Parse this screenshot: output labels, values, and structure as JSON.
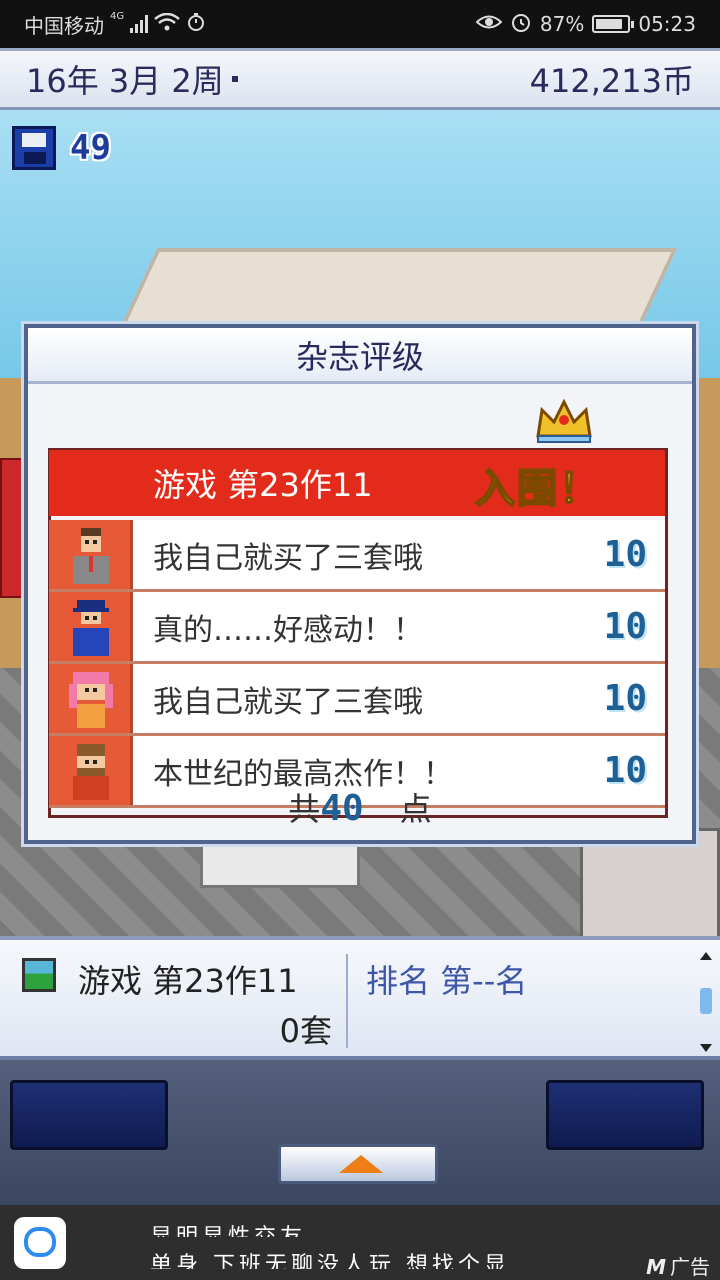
{
  "status_bar": {
    "carrier": "中国移动",
    "network": "4G",
    "battery": "87%",
    "battery_level": 0.87,
    "time": "05:23",
    "icons": [
      "signal-icon",
      "wifi-icon",
      "stopwatch-icon",
      "eye-icon",
      "alarm-icon",
      "battery-icon"
    ]
  },
  "top_bar": {
    "date": "16年 3月 2周",
    "money": "412,213币"
  },
  "save": {
    "icon": "floppy-disk-icon",
    "count": "49"
  },
  "dialog": {
    "title": "杂志评级",
    "header": "游戏 第23作11",
    "badge": "入围！",
    "crown_icon": "crown-icon",
    "reviews": [
      {
        "avatar": "reviewer-suit-man-icon",
        "comment": "我自己就买了三套哦",
        "score": "10"
      },
      {
        "avatar": "reviewer-cap-boy-icon",
        "comment": "真的……好感动！！",
        "score": "10"
      },
      {
        "avatar": "reviewer-pink-hair-girl-icon",
        "comment": "我自己就买了三套哦",
        "score": "10"
      },
      {
        "avatar": "reviewer-bearded-man-icon",
        "comment": "本世纪的最高杰作！！",
        "score": "10"
      }
    ],
    "total_prefix": "共",
    "total_value": "40",
    "total_suffix": "点"
  },
  "info_panel": {
    "game_icon": "game-cartridge-icon",
    "game_name": "游戏 第23作11",
    "sales": "0套",
    "rank": "排名 第--名"
  },
  "controls": {
    "up_icon": "arrow-up-icon"
  },
  "ad": {
    "logo_icon": "chat-app-logo-icon",
    "line1": "显明显性交友",
    "line2": "单身  下班无聊没人玩  想找个显",
    "label": "广告",
    "label_mark": "M"
  },
  "colors": {
    "header_red": "#e32b1b",
    "score_blue": "#1e5f96",
    "finalist_gold": "#f0c12a",
    "panel_border": "#4f638c"
  }
}
